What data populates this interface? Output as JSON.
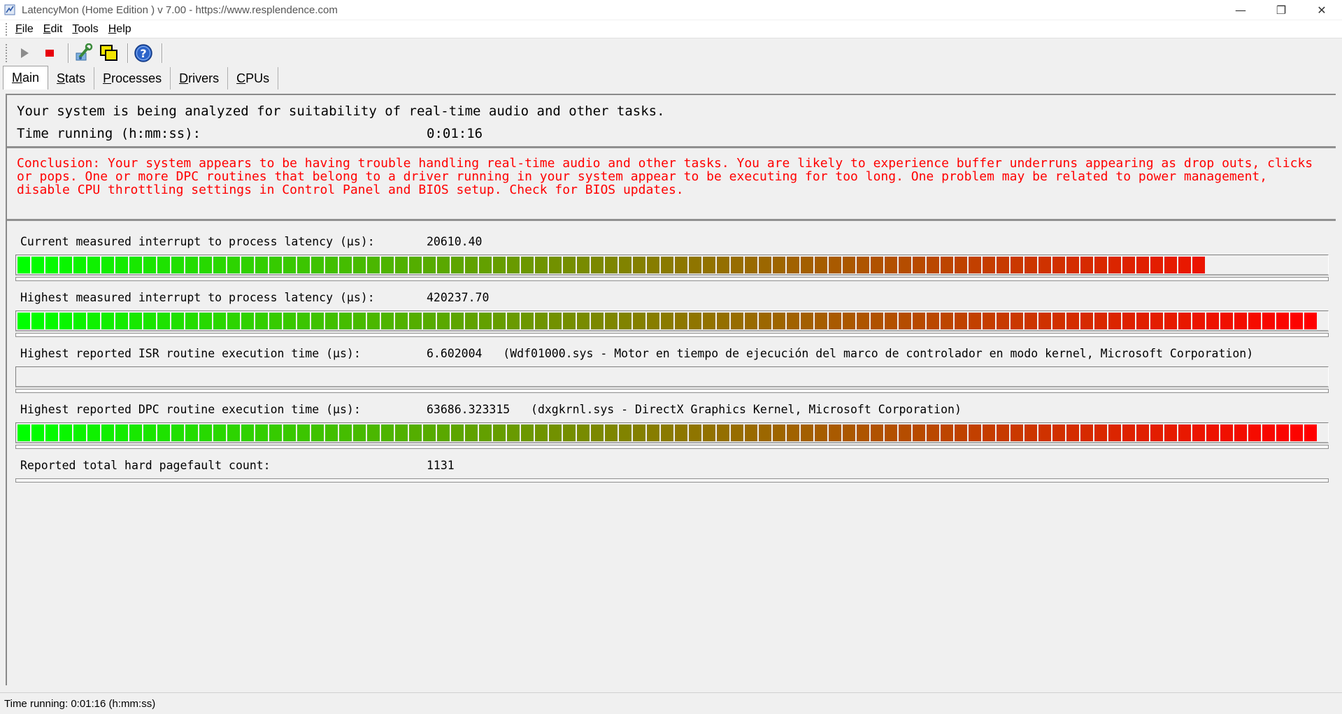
{
  "window": {
    "title": "LatencyMon  (Home Edition )  v 7.00 - https://www.resplendence.com",
    "minimize_glyph": "—",
    "maximize_glyph": "❐",
    "close_glyph": "✕"
  },
  "menu": [
    "File",
    "Edit",
    "Tools",
    "Help"
  ],
  "toolbar": {
    "icons": [
      "play-icon",
      "stop-icon",
      "wrench-icon",
      "windows-icon",
      "help-icon"
    ]
  },
  "tabs": [
    "Main",
    "Stats",
    "Processes",
    "Drivers",
    "CPUs"
  ],
  "active_tab": "Main",
  "status_header": {
    "message": "Your system is being analyzed for suitability of real-time audio and other tasks.",
    "time_label": "Time running (h:mm:ss):",
    "time_value": "0:01:16"
  },
  "conclusion": "Conclusion: Your system appears to be having trouble handling real-time audio and other tasks. You are likely to experience buffer underruns appearing as drop outs, clicks or pops. One or more DPC routines that belong to a driver running in your system appear to be executing for too long. One problem may be related to power management, disable CPU throttling settings in Control Panel and BIOS setup. Check for BIOS updates.",
  "colors": {
    "conclusion_text": "#ff0000",
    "bar_low": "#00ff00",
    "bar_mid": "#8a7a00",
    "bar_high": "#ff0000"
  },
  "metrics": [
    {
      "label": "Current measured interrupt to process latency (µs):",
      "value": "20610.40",
      "level": 0.918
    },
    {
      "label": "Highest measured interrupt to process latency (µs):",
      "value": "420237.70",
      "level": 1.0
    },
    {
      "label": "Highest reported ISR routine execution time (µs):",
      "value": "6.602004   (Wdf01000.sys - Motor en tiempo de ejecución del marco de controlador en modo kernel, Microsoft Corporation)",
      "level": 0.0
    },
    {
      "label": "Highest reported DPC routine execution time (µs):",
      "value": "63686.323315   (dxgkrnl.sys - DirectX Graphics Kernel, Microsoft Corporation)",
      "level": 1.0
    },
    {
      "label": "Reported total hard pagefault count:",
      "value": "1131"
    }
  ],
  "statusbar": "Time running: 0:01:16  (h:mm:ss)"
}
